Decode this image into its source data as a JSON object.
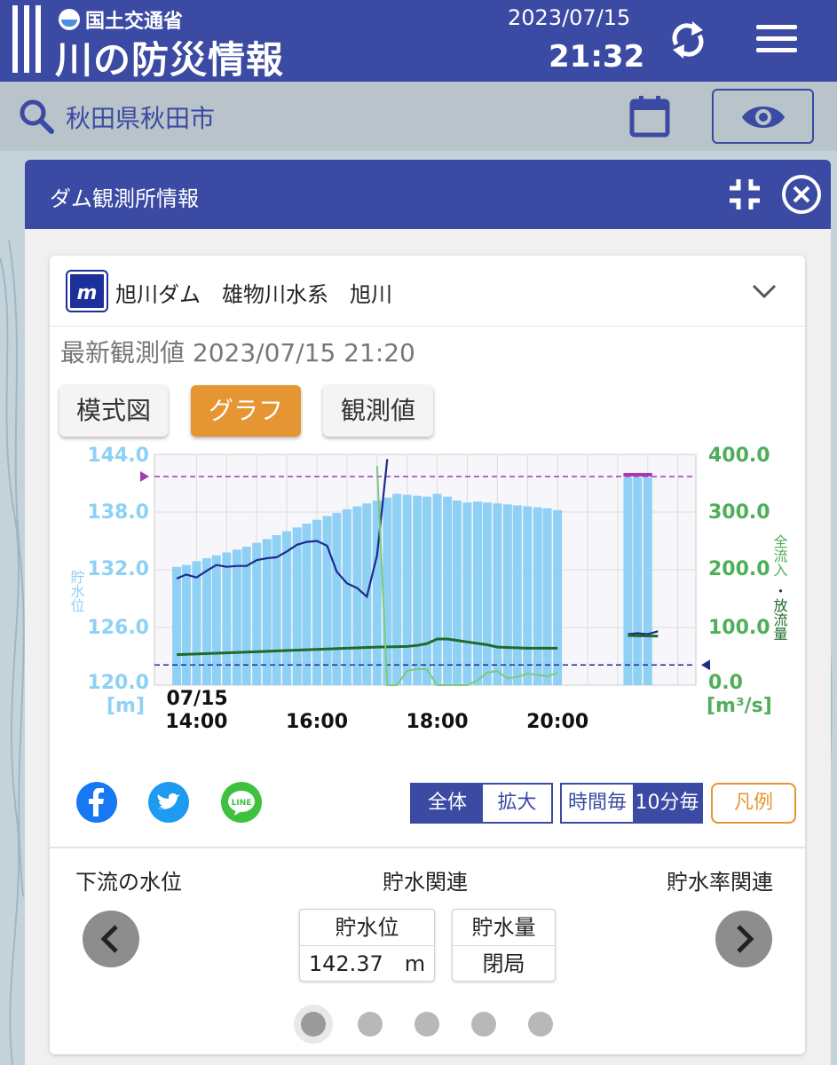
{
  "header": {
    "ministry": "国土交通省",
    "title": "川の防災情報",
    "date": "2023/07/15",
    "time": "21:32"
  },
  "search": {
    "location": "秋田県秋田市"
  },
  "panel": {
    "title": "ダム観測所情報"
  },
  "station": {
    "logo_text": "m",
    "name": "旭川ダム　雄物川水系　旭川",
    "latest": "最新観測値 2023/07/15 21:20"
  },
  "tabs": [
    {
      "label": "模式図",
      "active": false
    },
    {
      "label": "グラフ",
      "active": true
    },
    {
      "label": "観測値",
      "active": false
    }
  ],
  "chart_data": {
    "type": "bar",
    "left_axis": {
      "ticks": [
        "144.0",
        "138.0",
        "132.0",
        "126.0",
        "120.0"
      ],
      "label": "貯水位",
      "unit": "[m]",
      "range": [
        120,
        144
      ],
      "color": "#8fd0f5"
    },
    "right_axis": {
      "ticks": [
        "400.0",
        "300.0",
        "200.0",
        "100.0",
        "0.0"
      ],
      "label_part1": "全流入",
      "label_sep": "・",
      "label_part2": "放流量",
      "unit": "[m³/s]",
      "range": [
        0,
        400
      ],
      "color": "#4fae59"
    },
    "x_ticks": [
      {
        "date": "07/15",
        "time": "14:00",
        "hour": 14
      },
      {
        "date": "",
        "time": "16:00",
        "hour": 16
      },
      {
        "date": "",
        "time": "18:00",
        "hour": 18
      },
      {
        "date": "",
        "time": "20:00",
        "hour": 20
      }
    ],
    "x_range": [
      13.3,
      22.3
    ],
    "reference_lines": [
      {
        "name": "upper",
        "value": 141.7,
        "color": "#a23ab3"
      },
      {
        "name": "lower",
        "value": 122.1,
        "color": "#1e2b8c"
      }
    ],
    "series": [
      {
        "kind": "bar",
        "axis": "left",
        "color": "#8fd0f5",
        "hours": [
          13.67,
          13.83,
          14.0,
          14.17,
          14.33,
          14.5,
          14.67,
          14.83,
          15.0,
          15.17,
          15.33,
          15.5,
          15.67,
          15.83,
          16.0,
          16.17,
          16.33,
          16.5,
          16.67,
          16.83,
          17.0,
          17.17,
          17.33,
          17.5,
          17.67,
          17.83,
          18.0,
          18.17,
          18.33,
          18.5,
          18.67,
          18.83,
          19.0,
          19.17,
          19.33,
          19.5,
          19.67,
          19.83,
          20.0,
          21.17,
          21.33,
          21.5
        ],
        "values": [
          132.3,
          132.5,
          132.9,
          133.2,
          133.5,
          133.8,
          134.1,
          134.4,
          134.8,
          135.2,
          135.6,
          136.0,
          136.4,
          136.8,
          137.2,
          137.6,
          137.9,
          138.3,
          138.6,
          138.9,
          139.2,
          139.5,
          139.9,
          139.8,
          139.7,
          139.6,
          139.9,
          139.6,
          139.2,
          139.0,
          139.1,
          139.0,
          138.9,
          138.8,
          138.7,
          138.6,
          138.5,
          138.4,
          138.2,
          141.6,
          141.6,
          141.6
        ]
      },
      {
        "kind": "line",
        "axis": "left",
        "color": "#1e2b8c",
        "hours": [
          13.67,
          13.83,
          14.0,
          14.17,
          14.33,
          14.5,
          14.67,
          14.83,
          15.0,
          15.17,
          15.33,
          15.5,
          15.67,
          15.83,
          16.0,
          16.17,
          16.33,
          16.5,
          16.67,
          16.83,
          17.0,
          17.17,
          17.33
        ],
        "values": [
          131.1,
          131.5,
          131.2,
          131.9,
          132.5,
          132.3,
          132.4,
          132.4,
          133.0,
          133.2,
          133.3,
          133.9,
          134.6,
          134.9,
          135.0,
          134.5,
          131.8,
          130.6,
          130.1,
          129.2,
          133.5,
          143.5,
          null
        ]
      },
      {
        "kind": "line",
        "axis": "left",
        "color": "#1e2b8c",
        "hours": [
          21.17,
          21.33,
          21.5,
          21.67
        ],
        "values": [
          125.3,
          125.4,
          125.3,
          125.6
        ]
      },
      {
        "kind": "line",
        "axis": "right",
        "color": "#1f6a2a",
        "stroke": 3,
        "hours": [
          13.67,
          14.5,
          15.5,
          16.5,
          17.0,
          17.5,
          17.67,
          17.83,
          18.0,
          18.17,
          18.5,
          18.83,
          19.0,
          19.5,
          20.0
        ],
        "values": [
          53,
          56,
          60,
          64,
          66,
          67,
          69,
          72,
          80,
          80,
          75,
          70,
          66,
          64,
          64
        ]
      },
      {
        "kind": "line",
        "axis": "right",
        "color": "#7fc97a",
        "stroke": 2,
        "hours": [
          17.0,
          17.17,
          17.33,
          17.5,
          17.67,
          17.83,
          18.0,
          18.17,
          18.5,
          18.67,
          18.83,
          19.0,
          19.17,
          19.33,
          19.5,
          19.67,
          19.83,
          20.0
        ],
        "values": [
          380,
          0,
          0,
          25,
          28,
          27,
          0,
          0,
          0,
          8,
          22,
          24,
          12,
          14,
          20,
          18,
          15,
          22
        ]
      },
      {
        "kind": "line",
        "axis": "right",
        "color": "#1f6a2a",
        "stroke": 3,
        "hours": [
          21.17,
          21.67
        ],
        "values": [
          86,
          85
        ]
      }
    ]
  },
  "share": [
    {
      "name": "facebook",
      "color": "#1877f2"
    },
    {
      "name": "twitter",
      "color": "#1d9bf0"
    },
    {
      "name": "line",
      "color": "#3ec13e"
    }
  ],
  "range_toggle": {
    "all": "全体",
    "zoom": "拡大"
  },
  "interval_toggle": {
    "hourly": "時間毎",
    "ten_min": "10分毎"
  },
  "legend_label": "凡例",
  "sections": {
    "left": "下流の水位",
    "center": "貯水関連",
    "right": "貯水率関連"
  },
  "values": {
    "level_label": "貯水位",
    "level_value": "142.37　m",
    "volume_label": "貯水量",
    "volume_value": "閉局"
  },
  "pagination": {
    "count": 5,
    "active_index": 0
  }
}
